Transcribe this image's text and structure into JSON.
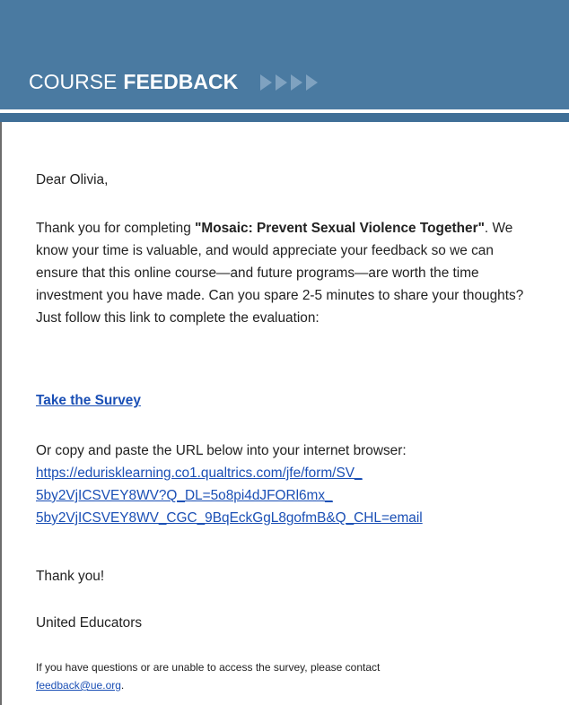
{
  "header": {
    "title_light": "COURSE",
    "title_bold": "FEEDBACK",
    "arrow_icon": "chevron-right-icon",
    "colors": {
      "band": "#4a7aa1",
      "bar": "#3f6f97",
      "arrows": "#7fa2c0"
    }
  },
  "email": {
    "greeting": "Dear Olivia,",
    "intro_before": "Thank you for completing ",
    "course_name": "\"Mosaic: Prevent Sexual Violence Together\"",
    "intro_after": ". We know your time is valuable, and would appreciate your feedback so we can ensure that this online course—and future programs—are worth the time investment you have made. Can you spare 2-5 minutes to share your thoughts? Just follow this link to complete the evaluation:",
    "survey_link_label": "Take the Survey",
    "copy_instruction": "Or copy and paste the URL below into your internet browser:",
    "url_line1": "https://edurisklearning.co1.qualtrics.com/jfe/form/SV_",
    "url_line2": "5by2VjICSVEY8WV?Q_DL=5o8pi4dJFORl6mx_",
    "url_line3": "5by2VjICSVEY8WV_CGC_9BqEckGgL8gofmB&Q_CHL=email",
    "thanks": "Thank you!",
    "signature": "United Educators",
    "help_text": "If you have questions or are unable to access the survey, please contact",
    "help_email": "feedback@ue.org",
    "help_end": "."
  }
}
